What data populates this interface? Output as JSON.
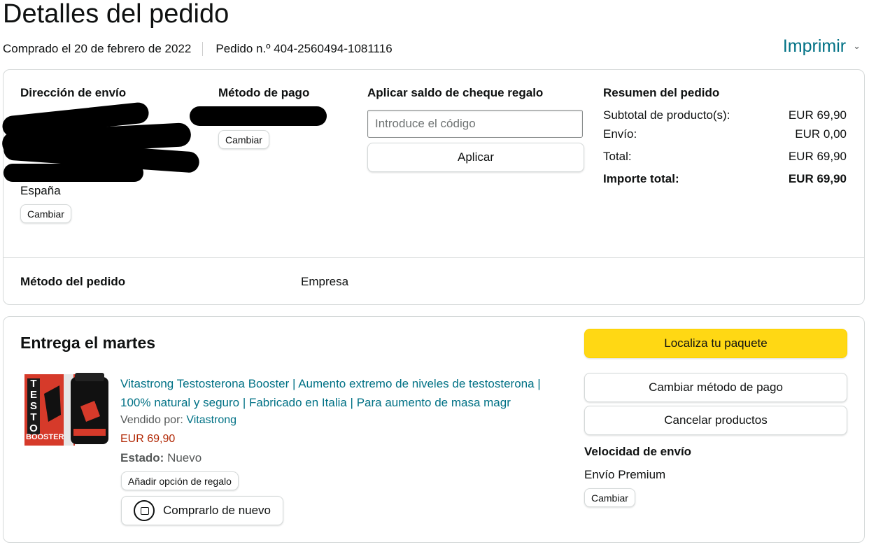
{
  "page": {
    "title": "Detalles del pedido",
    "purchased": "Comprado el 20 de febrero de 2022",
    "order_number": "Pedido n.º 404-2560494-1081116",
    "print_label": "Imprimir"
  },
  "shipping": {
    "heading": "Dirección de envío",
    "country": "España",
    "change_label": "Cambiar"
  },
  "payment": {
    "heading": "Método de pago",
    "change_label": "Cambiar"
  },
  "gift_card": {
    "heading": "Aplicar saldo de cheque regalo",
    "placeholder": "Introduce el código",
    "apply_label": "Aplicar"
  },
  "summary": {
    "heading": "Resumen del pedido",
    "rows": [
      {
        "label": "Subtotal de producto(s):",
        "value": "EUR 69,90"
      },
      {
        "label": "Envío:",
        "value": "EUR 0,00"
      },
      {
        "label": "Total:",
        "value": "EUR 69,90"
      }
    ],
    "grand_label": "Importe total:",
    "grand_value": "EUR 69,90"
  },
  "order_method": {
    "label": "Método del pedido",
    "value": "Empresa"
  },
  "delivery": {
    "heading": "Entrega el martes",
    "product_title": "Vitastrong Testosterona Booster | Aumento extremo de niveles de testosterona | 100% natural y seguro | Fabricado en Italia | Para aumento de masa magr",
    "sold_by_label": "Vendido por:",
    "seller": "Vitastrong",
    "price": "EUR 69,90",
    "condition_label": "Estado:",
    "condition_value": "Nuevo",
    "gift_label": "Añadir opción de regalo",
    "buy_again_label": "Comprarlo de nuevo",
    "product_image_text_1": "TESTO",
    "product_image_text_2": "BOOSTER"
  },
  "actions": {
    "track": "Localiza tu paquete",
    "change_payment": "Cambiar método de pago",
    "cancel": "Cancelar productos"
  },
  "shipping_speed": {
    "heading": "Velocidad de envío",
    "value": "Envío Premium",
    "change_label": "Cambiar"
  },
  "colors": {
    "link": "#007185",
    "price": "#b12704",
    "primary_button": "#ffd814"
  }
}
